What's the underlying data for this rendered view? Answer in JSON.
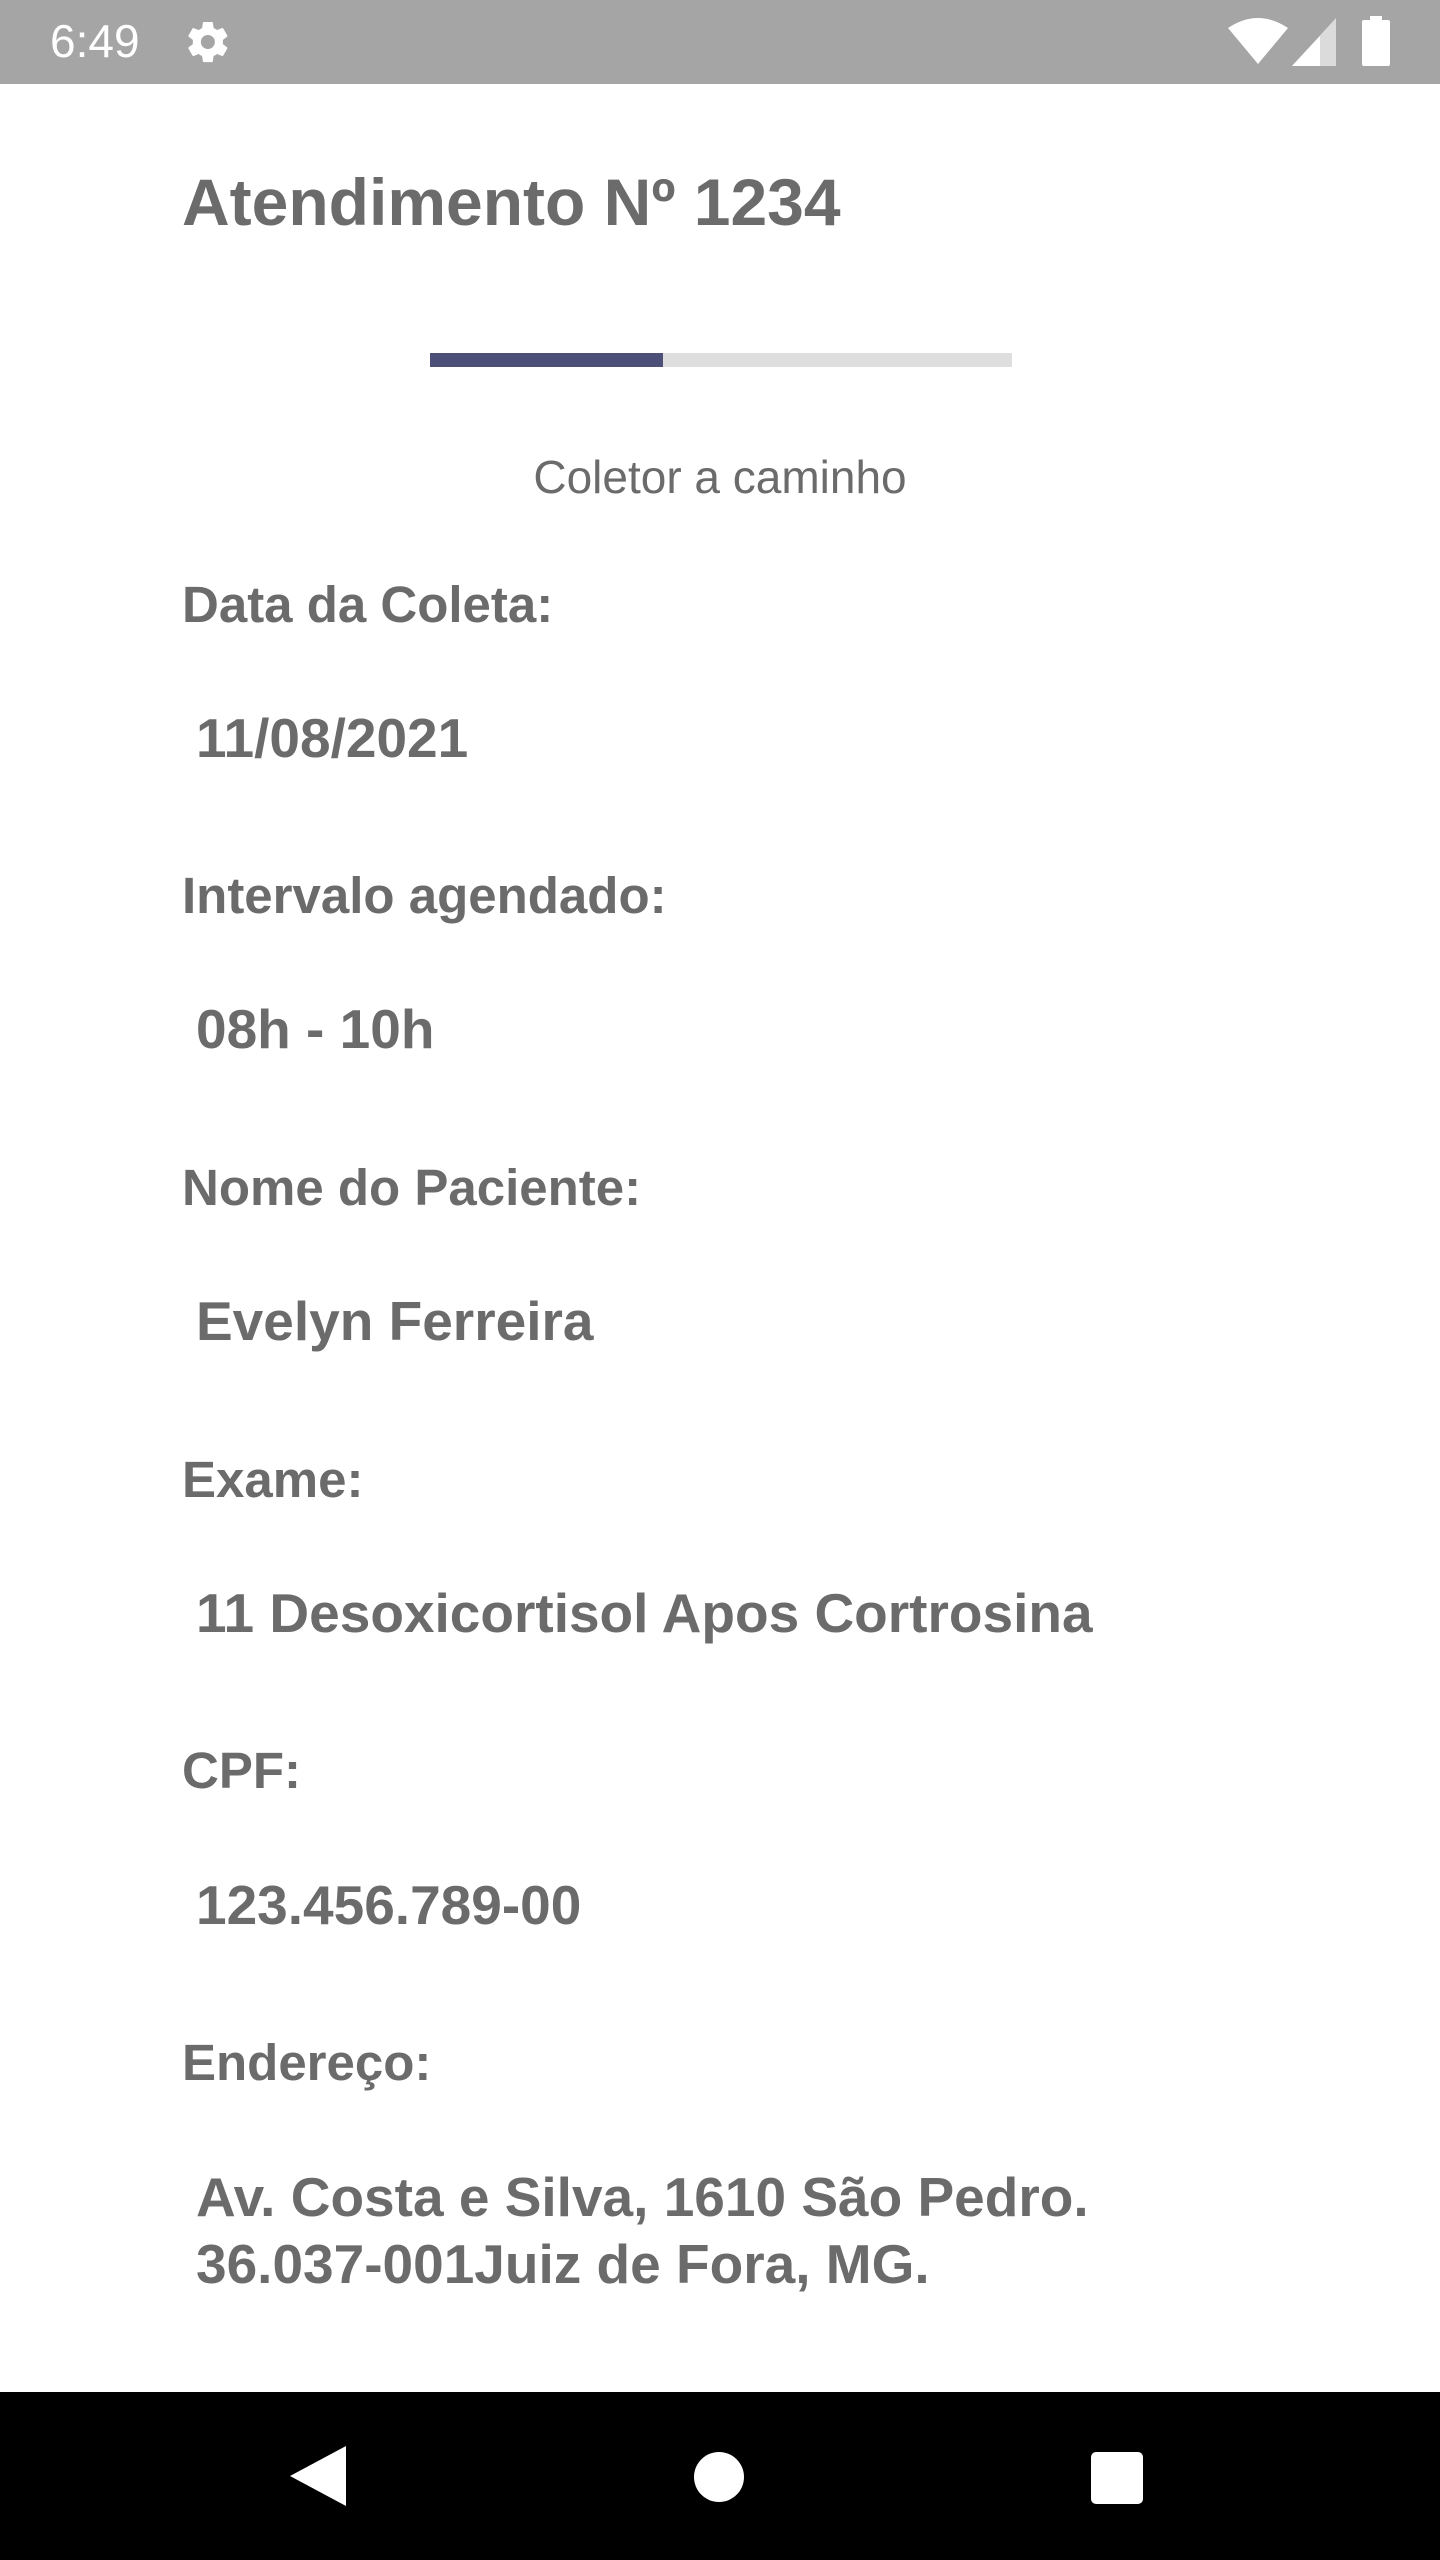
{
  "status_bar": {
    "time": "6:49",
    "icons": [
      "gear-icon",
      "wifi-icon",
      "signal-icon",
      "battery-icon"
    ],
    "background": "#a5a5a5"
  },
  "header": {
    "title": "Atendimento Nº 1234"
  },
  "progress": {
    "fraction": 0.4,
    "fill_color": "#4c5078",
    "track_color": "#dedede",
    "status_label": "Coletor a caminho"
  },
  "fields": {
    "collection_date": {
      "label": "Data da Coleta:",
      "value": "11/08/2021"
    },
    "scheduled_interval": {
      "label": "Intervalo agendado:",
      "value": "08h - 10h"
    },
    "patient_name": {
      "label": "Nome do Paciente:",
      "value": "Evelyn Ferreira"
    },
    "exam": {
      "label": "Exame:",
      "value": "11 Desoxicortisol Apos Cortrosina"
    },
    "cpf": {
      "label": "CPF:",
      "value": "123.456.789-00"
    },
    "address": {
      "label": "Endereço:",
      "line1": "Av. Costa e Silva, 1610 São Pedro.",
      "line2": "36.037-001Juiz de Fora, MG."
    }
  },
  "nav_bar": {
    "icons": [
      "back-icon",
      "home-icon",
      "recents-icon"
    ]
  }
}
